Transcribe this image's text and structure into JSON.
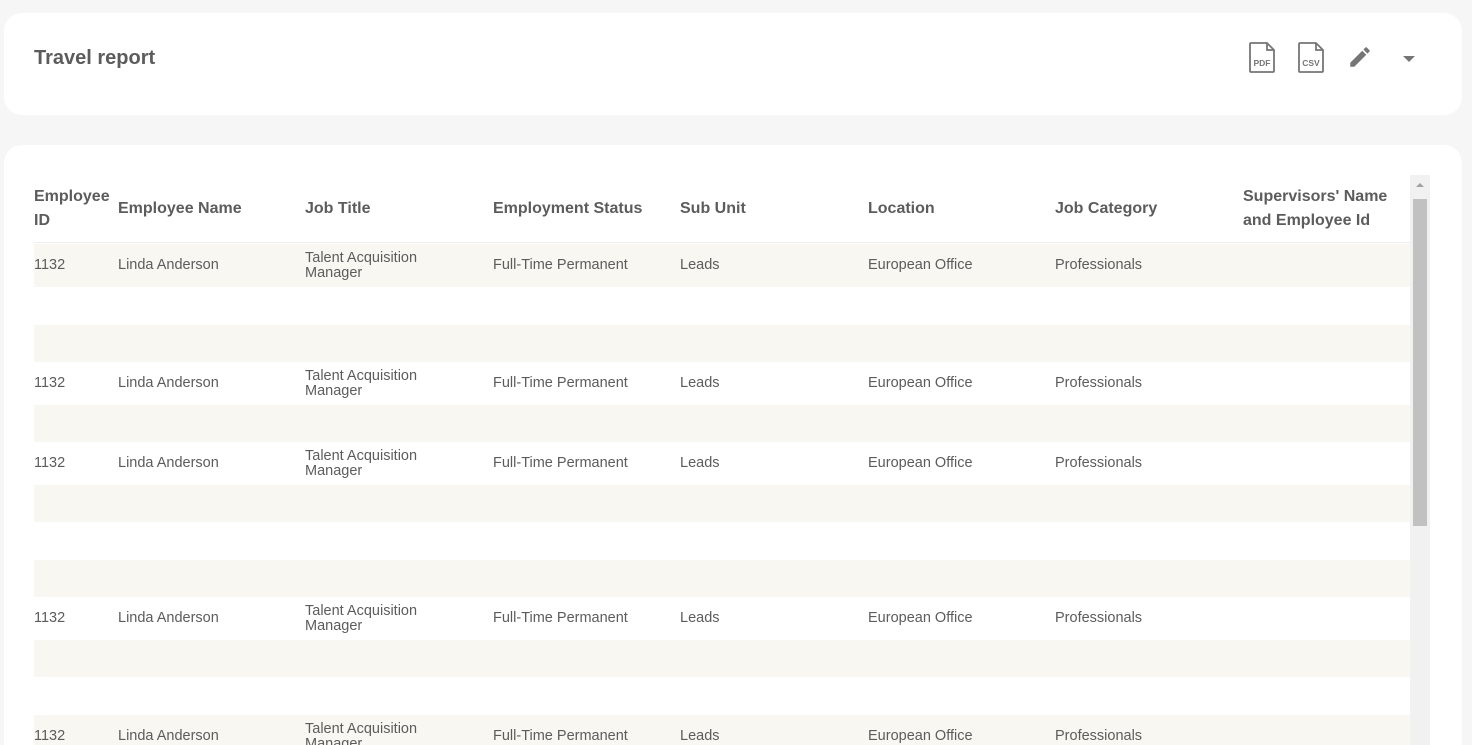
{
  "header": {
    "title": "Travel report",
    "actions": [
      {
        "name": "pdf-export",
        "icon": "pdf-file-icon",
        "label": "PDF"
      },
      {
        "name": "csv-export",
        "icon": "csv-file-icon",
        "label": "CSV"
      },
      {
        "name": "edit",
        "icon": "pencil-icon"
      },
      {
        "name": "more",
        "icon": "caret-down-icon"
      }
    ]
  },
  "table": {
    "columns": [
      "Employee ID",
      "Employee Name",
      "Job Title",
      "Employment Status",
      "Sub Unit",
      "Location",
      "Job Category",
      "Supervisors' Name and Employee Id"
    ],
    "rows": [
      {
        "id": "1132",
        "name": "Linda Anderson",
        "job_title": "Talent Acquisition Manager",
        "status": "Full-Time Permanent",
        "sub_unit": "Leads",
        "location": "European Office",
        "category": "Professionals",
        "supervisor": ""
      },
      {
        "id": "",
        "name": "",
        "job_title": "",
        "status": "",
        "sub_unit": "",
        "location": "",
        "category": "",
        "supervisor": ""
      },
      {
        "id": "",
        "name": "",
        "job_title": "",
        "status": "",
        "sub_unit": "",
        "location": "",
        "category": "",
        "supervisor": ""
      },
      {
        "id": "1132",
        "name": "Linda Anderson",
        "job_title": "Talent Acquisition Manager",
        "status": "Full-Time Permanent",
        "sub_unit": "Leads",
        "location": "European Office",
        "category": "Professionals",
        "supervisor": ""
      },
      {
        "id": "",
        "name": "",
        "job_title": "",
        "status": "",
        "sub_unit": "",
        "location": "",
        "category": "",
        "supervisor": ""
      },
      {
        "id": "1132",
        "name": "Linda Anderson",
        "job_title": "Talent Acquisition Manager",
        "status": "Full-Time Permanent",
        "sub_unit": "Leads",
        "location": "European Office",
        "category": "Professionals",
        "supervisor": ""
      },
      {
        "id": "",
        "name": "",
        "job_title": "",
        "status": "",
        "sub_unit": "",
        "location": "",
        "category": "",
        "supervisor": ""
      },
      {
        "id": "",
        "name": "",
        "job_title": "",
        "status": "",
        "sub_unit": "",
        "location": "",
        "category": "",
        "supervisor": ""
      },
      {
        "id": "",
        "name": "",
        "job_title": "",
        "status": "",
        "sub_unit": "",
        "location": "",
        "category": "",
        "supervisor": ""
      },
      {
        "id": "1132",
        "name": "Linda Anderson",
        "job_title": "Talent Acquisition Manager",
        "status": "Full-Time Permanent",
        "sub_unit": "Leads",
        "location": "European Office",
        "category": "Professionals",
        "supervisor": ""
      },
      {
        "id": "",
        "name": "",
        "job_title": "",
        "status": "",
        "sub_unit": "",
        "location": "",
        "category": "",
        "supervisor": ""
      },
      {
        "id": "",
        "name": "",
        "job_title": "",
        "status": "",
        "sub_unit": "",
        "location": "",
        "category": "",
        "supervisor": ""
      },
      {
        "id": "1132",
        "name": "Linda Anderson",
        "job_title": "Talent Acquisition Manager",
        "status": "Full-Time Permanent",
        "sub_unit": "Leads",
        "location": "European Office",
        "category": "Professionals",
        "supervisor": ""
      }
    ]
  },
  "colors": {
    "page_bg": "#f6f6f6",
    "card_bg": "#ffffff",
    "row_alt_bg": "#f8f7f1",
    "text": "#5c5c5c",
    "icon": "#767676"
  }
}
